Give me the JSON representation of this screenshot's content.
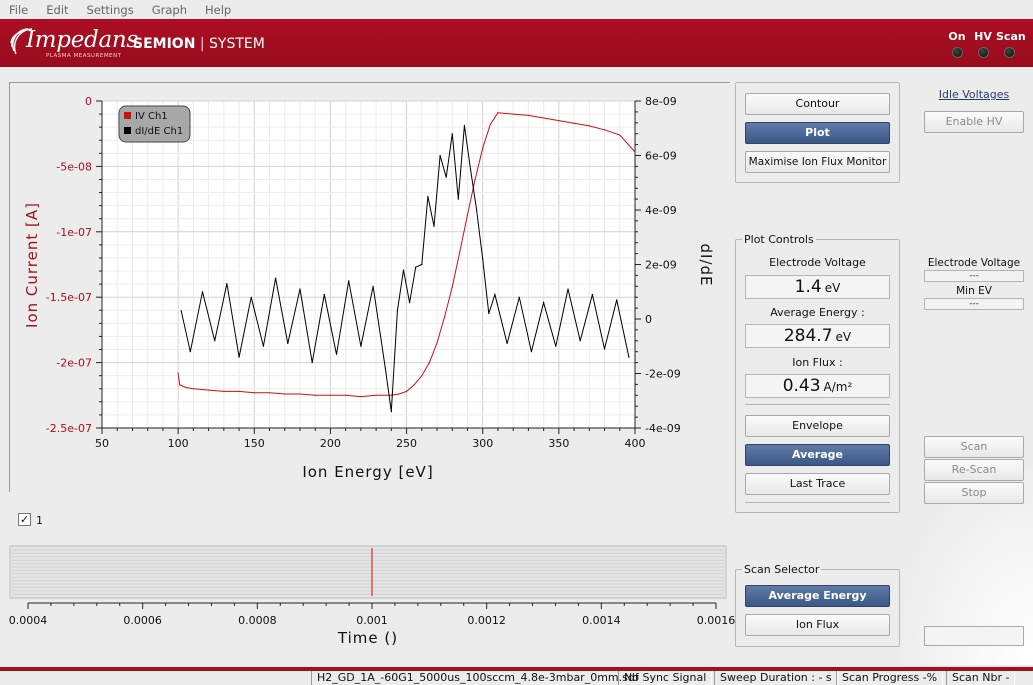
{
  "menu": {
    "items": [
      "File",
      "Edit",
      "Settings",
      "Graph",
      "Help"
    ]
  },
  "brand": {
    "name": "Impedans",
    "tagline": "PLASMA MEASUREMENT",
    "product_bold": "SEMION",
    "product_rest": "SYSTEM"
  },
  "status_lamps": [
    {
      "label": "On"
    },
    {
      "label": "HV"
    },
    {
      "label": "Scan"
    }
  ],
  "colors": {
    "brand_red": "#a50e20",
    "iv_series": "#cc1111",
    "didE_series": "#000000",
    "active_button": "#4a6793"
  },
  "chart_data": {
    "type": "line",
    "xlabel": "Ion Energy [eV]",
    "ylabel": "Ion Current [A]",
    "y2label": "dI/dE",
    "xlim": [
      50,
      400
    ],
    "xticks": [
      "50",
      "100",
      "150",
      "200",
      "250",
      "300",
      "350",
      "400"
    ],
    "ylim": [
      -2.5e-07,
      0
    ],
    "yticks": [
      "0",
      "-5e-08",
      "-1e-07",
      "-1.5e-07",
      "-2e-07",
      "-2.5e-07"
    ],
    "y2lim": [
      -4e-09,
      8e-09
    ],
    "y2ticks": [
      "8e-09",
      "6e-09",
      "4e-09",
      "2e-09",
      "0",
      "-2e-09",
      "-4e-09"
    ],
    "grid": true,
    "legend_position": "top-left",
    "series": [
      {
        "name": "IV Ch1",
        "axis": "left",
        "x": [
          100,
          101,
          105,
          110,
          120,
          130,
          140,
          150,
          160,
          170,
          180,
          190,
          200,
          210,
          220,
          230,
          240,
          245,
          250,
          255,
          260,
          265,
          270,
          275,
          280,
          285,
          290,
          295,
          300,
          305,
          310,
          320,
          330,
          340,
          350,
          360,
          370,
          380,
          390,
          400
        ],
        "y": [
          -2.08e-07,
          -2.17e-07,
          -2.19e-07,
          -2.2e-07,
          -2.21e-07,
          -2.22e-07,
          -2.22e-07,
          -2.23e-07,
          -2.23e-07,
          -2.24e-07,
          -2.24e-07,
          -2.25e-07,
          -2.25e-07,
          -2.25e-07,
          -2.26e-07,
          -2.25e-07,
          -2.25e-07,
          -2.24e-07,
          -2.22e-07,
          -2.17e-07,
          -2.1e-07,
          -2e-07,
          -1.85e-07,
          -1.65e-07,
          -1.42e-07,
          -1.15e-07,
          -8.7e-08,
          -6e-08,
          -3.6e-08,
          -1.8e-08,
          -9e-09,
          -1e-08,
          -1.1e-08,
          -1.3e-08,
          -1.5e-08,
          -1.7e-08,
          -1.9e-08,
          -2.2e-08,
          -2.6e-08,
          -3.9e-08
        ]
      },
      {
        "name": "dI/dE Ch1",
        "axis": "right",
        "x": [
          102,
          108,
          116,
          124,
          132,
          140,
          148,
          156,
          164,
          172,
          180,
          188,
          196,
          204,
          212,
          220,
          228,
          236,
          240,
          244,
          248,
          252,
          256,
          260,
          264,
          268,
          272,
          276,
          280,
          284,
          288,
          292,
          296,
          300,
          304,
          308,
          316,
          324,
          332,
          340,
          348,
          356,
          364,
          372,
          380,
          388,
          396
        ],
        "y": [
          3e-10,
          -1.2e-09,
          1e-09,
          -8e-10,
          1.3e-09,
          -1.4e-09,
          8e-10,
          -1e-09,
          1.5e-09,
          -9e-10,
          1.1e-09,
          -1.6e-09,
          9e-10,
          -1.3e-09,
          1.4e-09,
          -1e-09,
          1.2e-09,
          -1.8e-09,
          -3.4e-09,
          3e-10,
          1.8e-09,
          6e-10,
          1.9e-09,
          2e-09,
          4.5e-09,
          3.4e-09,
          6e-09,
          5.2e-09,
          6.8e-09,
          4.4e-09,
          7.1e-09,
          5.5e-09,
          4e-09,
          2.2e-09,
          2e-10,
          9e-10,
          -9e-10,
          8e-10,
          -1.2e-09,
          6e-10,
          -1e-09,
          1.1e-09,
          -8e-10,
          9e-10,
          -1.1e-09,
          7e-10,
          -1.4e-09
        ]
      }
    ]
  },
  "timeline": {
    "checkbox_label": "1",
    "checked": true,
    "xlabel": "Time ()",
    "xlim": [
      0.0004,
      0.0016
    ],
    "xticks": [
      "0.0004",
      "0.0006",
      "0.0008",
      "0.001",
      "0.0012",
      "0.0014",
      "0.0016"
    ],
    "marker_value": 0.001
  },
  "view_buttons": {
    "contour": "Contour",
    "plot": "Plot",
    "maximise": "Maximise Ion Flux Monitor"
  },
  "plot_controls": {
    "title": "Plot Controls",
    "electrode_voltage_label": "Electrode Voltage",
    "electrode_voltage_value": "1.4",
    "electrode_voltage_unit": "eV",
    "average_energy_label": "Average Energy :",
    "average_energy_value": "284.7",
    "average_energy_unit": "eV",
    "ion_flux_label": "Ion Flux :",
    "ion_flux_value": "0.43",
    "ion_flux_unit": "A/m²",
    "envelope": "Envelope",
    "average": "Average",
    "last_trace": "Last Trace"
  },
  "scan_selector": {
    "title": "Scan Selector",
    "average_energy": "Average Energy",
    "ion_flux": "Ion Flux"
  },
  "idle_voltages": {
    "link": "Idle Voltages",
    "enable_hv": "Enable HV",
    "electrode_voltage_label": "Electrode Voltage",
    "electrode_voltage_value": "---",
    "min_ev_label": "Min EV",
    "min_ev_value": "---"
  },
  "scan_buttons": {
    "scan": "Scan",
    "rescan": "Re-Scan",
    "stop": "Stop"
  },
  "statusbar": {
    "file": "H2_GD_1A_-60G1_5000us_100sccm_4.8e-3mbar_0mm.sdf",
    "sync": "No Sync Signal",
    "sweep": "Sweep Duration : - s",
    "progress": "Scan Progress -%",
    "scan_nbr": "Scan Nbr -"
  }
}
